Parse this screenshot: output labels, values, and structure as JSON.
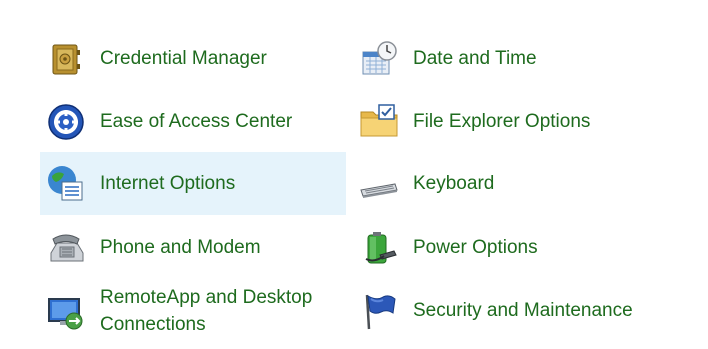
{
  "items": [
    {
      "label": "Credential Manager",
      "icon": "vault-icon"
    },
    {
      "label": "Date and Time",
      "icon": "calendar-clock-icon"
    },
    {
      "label": "Ease of Access Center",
      "icon": "ease-of-access-icon"
    },
    {
      "label": "File Explorer Options",
      "icon": "folder-check-icon"
    },
    {
      "label": "Internet Options",
      "icon": "globe-options-icon"
    },
    {
      "label": "Keyboard",
      "icon": "keyboard-icon"
    },
    {
      "label": "Phone and Modem",
      "icon": "phone-icon"
    },
    {
      "label": "Power Options",
      "icon": "battery-plug-icon"
    },
    {
      "label": "RemoteApp and Desktop",
      "label2": "Connections",
      "icon": "remote-desktop-icon"
    },
    {
      "label": "Security and Maintenance",
      "icon": "flag-icon"
    }
  ],
  "colors": {
    "link_text": "#1e6b1e",
    "hover_bg": "#e5f3fb"
  }
}
